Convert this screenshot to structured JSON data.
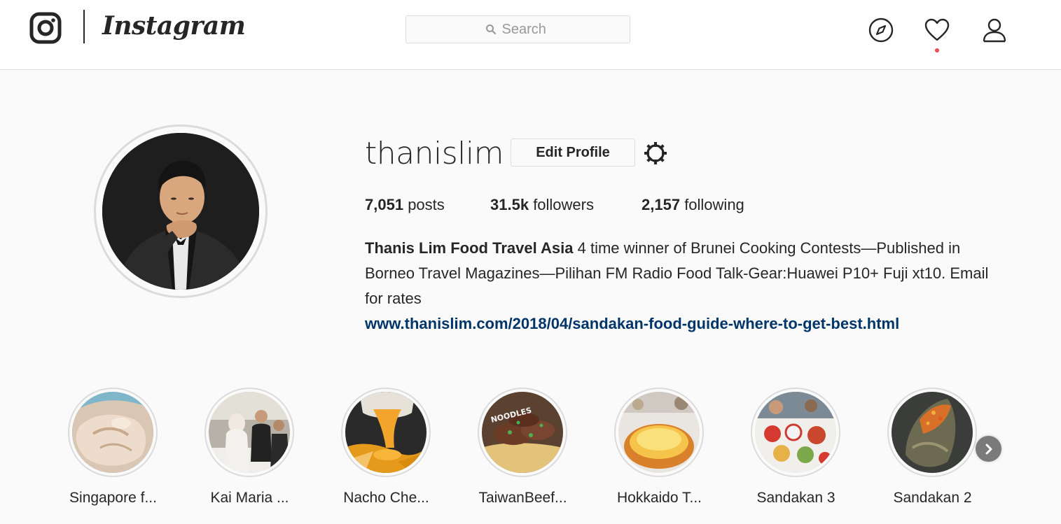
{
  "app": {
    "wordmark": "Instagram",
    "icons": {
      "logo": "camera-glyph-icon",
      "explore": "compass-icon",
      "activity": "heart-icon",
      "profile": "person-icon"
    },
    "colors": {
      "notification_dot": "#ed4956",
      "link": "#003569",
      "border": "#dbdbdb"
    }
  },
  "search": {
    "placeholder": "Search"
  },
  "profile": {
    "username": "thanislim",
    "edit_label": "Edit Profile",
    "stats": {
      "posts_count": "7,051",
      "posts_label": "posts",
      "followers_count": "31.5k",
      "followers_label": "followers",
      "following_count": "2,157",
      "following_label": "following"
    },
    "bio": {
      "name": "Thanis Lim Food Travel Asia",
      "text": "4 time winner of Brunei Cooking Contests—Published in Borneo Travel Magazines—Pilihan FM Radio Food Talk-Gear:Huawei P10+ Fuji xt10. Email for rates",
      "link": "www.thanislim.com/2018/04/sandakan-food-guide-where-to-get-best.html"
    }
  },
  "highlights": [
    {
      "label": "Singapore f..."
    },
    {
      "label": "Kai Maria ..."
    },
    {
      "label": "Nacho Che..."
    },
    {
      "label": "TaiwanBeef..."
    },
    {
      "label": "Hokkaido T..."
    },
    {
      "label": "Sandakan 3"
    },
    {
      "label": "Sandakan 2"
    }
  ],
  "highlight_overlay_text": "NOODLES"
}
